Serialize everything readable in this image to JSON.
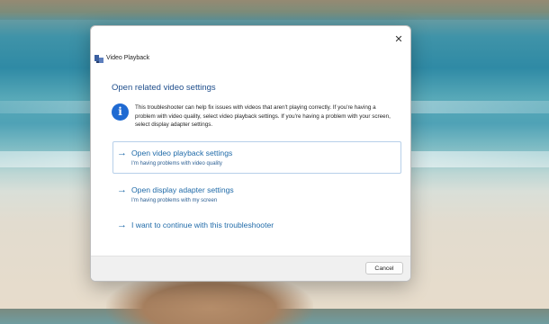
{
  "dialog": {
    "title": "Video Playback",
    "close_symbol": "✕",
    "heading": "Open related video settings",
    "info_icon": "info-icon",
    "info_text": "This troubleshooter can help fix issues with videos that aren't playing correctly. If you're having a problem with video quality, select video playback settings. If you're having a problem with your screen, select display adapter settings.",
    "options": [
      {
        "icon": "arrow-right-icon",
        "arrow": "→",
        "title": "Open video playback settings",
        "subtitle": "I'm having problems with video quality",
        "selected": true
      },
      {
        "icon": "arrow-right-icon",
        "arrow": "→",
        "title": "Open display adapter settings",
        "subtitle": "I'm having problems with my screen",
        "selected": false
      },
      {
        "icon": "arrow-right-icon",
        "arrow": "→",
        "title": "I want to continue with this troubleshooter",
        "subtitle": "",
        "selected": false
      }
    ],
    "cancel_label": "Cancel"
  },
  "colors": {
    "accent": "#1f6aa8",
    "heading": "#1f4e8c",
    "info_icon": "#1f6ad2"
  }
}
